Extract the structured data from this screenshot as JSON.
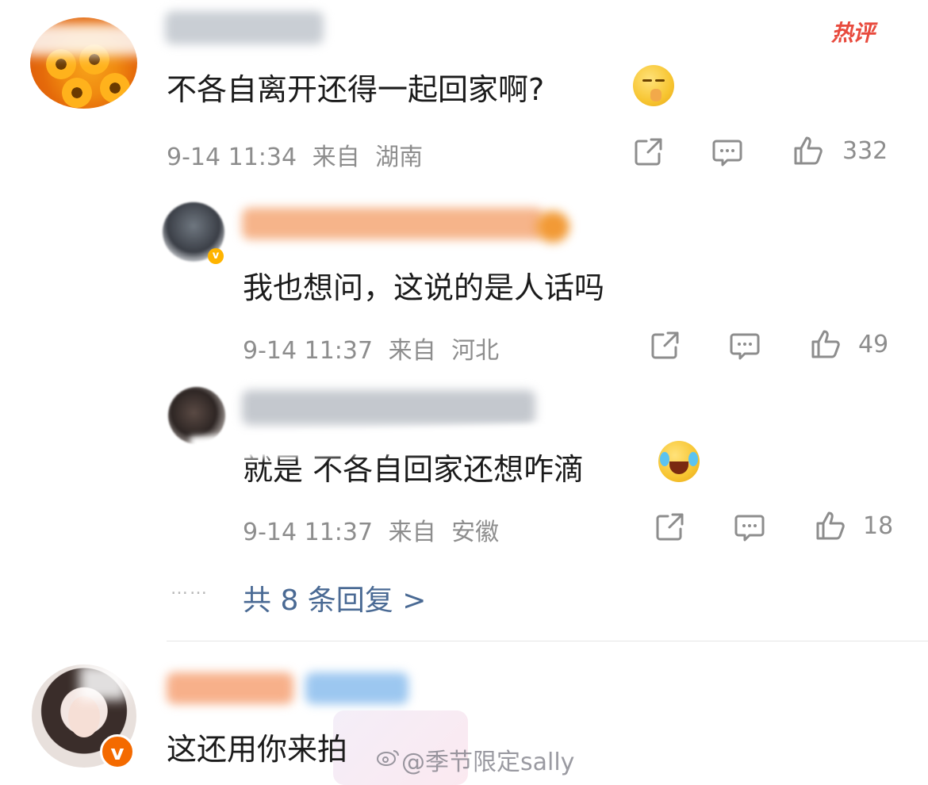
{
  "badge": {
    "hot_label": "热评"
  },
  "comments": [
    {
      "text": "不各自离开还得一起回家啊?",
      "time": "9-14 11:34",
      "from_label": "来自",
      "location": "湖南",
      "likes": "332",
      "emoji": "shush-face"
    },
    {
      "text": "我也想问，这说的是人话吗",
      "time": "9-14 11:37",
      "from_label": "来自",
      "location": "河北",
      "likes": "49"
    },
    {
      "text": "就是 不各自回家还想咋滴",
      "time": "9-14 11:37",
      "from_label": "来自",
      "location": "安徽",
      "likes": "18",
      "emoji": "laugh-cry"
    },
    {
      "text": "这还用你来拍"
    }
  ],
  "replies": {
    "dots": "……",
    "label": "共 8 条回复 >"
  },
  "watermark": {
    "text": "@季节限定sally"
  },
  "colors": {
    "hot": "#e84a3d",
    "link": "#4a6a94",
    "meta": "#8d8d8d",
    "verified": "#f46a00"
  }
}
